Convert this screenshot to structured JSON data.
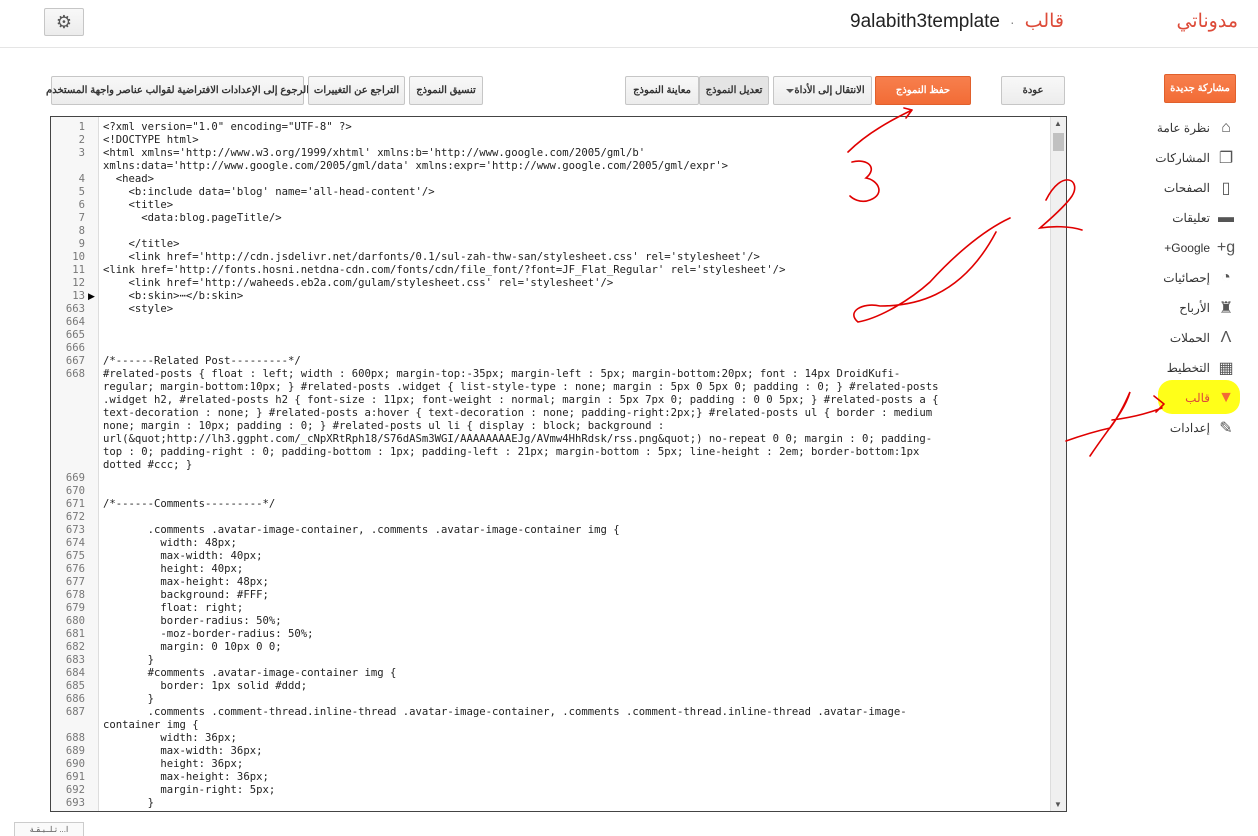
{
  "header": {
    "settings_icon": "gear-icon",
    "blog_name": "9alabith3template",
    "separator": "·",
    "page_title": "قالب",
    "brand": "مدوناتي"
  },
  "toolbar": {
    "reset_widgets": "الرجوع إلى الإعدادات الافتراضية لقوالب عناصر واجهة المستخدم",
    "revert_changes": "التراجع عن التغييرات",
    "format_template": "تنسيق النموذج",
    "preview_template": "معاينة النموذج",
    "edit_template": "تعديل النموذج",
    "jump_to_widget": "الانتقال إلى الأداة",
    "save_template": "حفظ النموذج",
    "back": "عودة"
  },
  "sidebar": {
    "new_post": "مشاركة جديدة",
    "items": [
      {
        "label": "نظرة عامة",
        "icon": "home-icon"
      },
      {
        "label": "المشاركات",
        "icon": "posts-icon"
      },
      {
        "label": "الصفحات",
        "icon": "pages-icon"
      },
      {
        "label": "تعليقات",
        "icon": "comment-icon"
      },
      {
        "label": "Google+",
        "icon": "google-plus-icon"
      },
      {
        "label": "إحصائيات",
        "icon": "pie-chart-icon"
      },
      {
        "label": "الأرباح",
        "icon": "trophy-icon"
      },
      {
        "label": "الحملات",
        "icon": "adwords-icon"
      },
      {
        "label": "التخطيط",
        "icon": "layout-icon"
      },
      {
        "label": "قالب",
        "icon": "paint-roller-icon"
      },
      {
        "label": "إعدادات",
        "icon": "wrench-icon"
      }
    ]
  },
  "editor": {
    "lines": [
      {
        "n": "1",
        "t": "<?xml version=\"1.0\" encoding=\"UTF-8\" ?>"
      },
      {
        "n": "2",
        "t": "<!DOCTYPE html>"
      },
      {
        "n": "3",
        "t": "<html xmlns='http://www.w3.org/1999/xhtml' xmlns:b='http://www.google.com/2005/gml/b'"
      },
      {
        "n": "",
        "t": "xmlns:data='http://www.google.com/2005/gml/data' xmlns:expr='http://www.google.com/2005/gml/expr'>"
      },
      {
        "n": "4",
        "t": "  <head>"
      },
      {
        "n": "5",
        "t": "    <b:include data='blog' name='all-head-content'/>"
      },
      {
        "n": "6",
        "t": "    <title>"
      },
      {
        "n": "7",
        "t": "      <data:blog.pageTitle/>"
      },
      {
        "n": "8",
        "t": ""
      },
      {
        "n": "9",
        "t": "    </title>"
      },
      {
        "n": "10",
        "t": "    <link href='http://cdn.jsdelivr.net/darfonts/0.1/sul-zah-thw-san/stylesheet.css' rel='stylesheet'/>"
      },
      {
        "n": "11",
        "t": "<link href='http://fonts.hosni.netdna-cdn.com/fonts/cdn/file_font/?font=JF_Flat_Regular' rel='stylesheet'/>"
      },
      {
        "n": "12",
        "t": "    <link href='http://waheeds.eb2a.com/gulam/stylesheet.css' rel='stylesheet'/>"
      },
      {
        "n": "13",
        "t": "    <b:skin>⋯</b:skin>"
      },
      {
        "n": "663",
        "t": "    <style>"
      },
      {
        "n": "664",
        "t": ""
      },
      {
        "n": "665",
        "t": ""
      },
      {
        "n": "666",
        "t": ""
      },
      {
        "n": "667",
        "t": "/*------Related Post---------*/"
      },
      {
        "n": "668",
        "t": "#related-posts { float : left; width : 600px; margin-top:-35px; margin-left : 5px; margin-bottom:20px; font : 14px DroidKufi-"
      },
      {
        "n": "",
        "t": "regular; margin-bottom:10px; } #related-posts .widget { list-style-type : none; margin : 5px 0 5px 0; padding : 0; } #related-posts"
      },
      {
        "n": "",
        "t": ".widget h2, #related-posts h2 { font-size : 11px; font-weight : normal; margin : 5px 7px 0; padding : 0 0 5px; } #related-posts a {"
      },
      {
        "n": "",
        "t": "text-decoration : none; } #related-posts a:hover { text-decoration : none; padding-right:2px;} #related-posts ul { border : medium"
      },
      {
        "n": "",
        "t": "none; margin : 10px; padding : 0; } #related-posts ul li { display : block; background :"
      },
      {
        "n": "",
        "t": "url(&quot;http://lh3.ggpht.com/_cNpXRtRph18/S76dASm3WGI/AAAAAAAAEJg/AVmw4HhRdsk/rss.png&quot;) no-repeat 0 0; margin : 0; padding-"
      },
      {
        "n": "",
        "t": "top : 0; padding-right : 0; padding-bottom : 1px; padding-left : 21px; margin-bottom : 5px; line-height : 2em; border-bottom:1px"
      },
      {
        "n": "",
        "t": "dotted #ccc; }"
      },
      {
        "n": "669",
        "t": ""
      },
      {
        "n": "670",
        "t": ""
      },
      {
        "n": "671",
        "t": "/*------Comments---------*/"
      },
      {
        "n": "672",
        "t": ""
      },
      {
        "n": "673",
        "t": "       .comments .avatar-image-container, .comments .avatar-image-container img {"
      },
      {
        "n": "674",
        "t": "         width: 48px;"
      },
      {
        "n": "675",
        "t": "         max-width: 40px;"
      },
      {
        "n": "676",
        "t": "         height: 40px;"
      },
      {
        "n": "677",
        "t": "         max-height: 48px;"
      },
      {
        "n": "678",
        "t": "         background: #FFF;"
      },
      {
        "n": "679",
        "t": "         float: right;"
      },
      {
        "n": "680",
        "t": "         border-radius: 50%;"
      },
      {
        "n": "681",
        "t": "         -moz-border-radius: 50%;"
      },
      {
        "n": "682",
        "t": "         margin: 0 10px 0 0;"
      },
      {
        "n": "683",
        "t": "       }"
      },
      {
        "n": "684",
        "t": "       #comments .avatar-image-container img {"
      },
      {
        "n": "685",
        "t": "         border: 1px solid #ddd;"
      },
      {
        "n": "686",
        "t": "       }"
      },
      {
        "n": "687",
        "t": "       .comments .comment-thread.inline-thread .avatar-image-container, .comments .comment-thread.inline-thread .avatar-image-"
      },
      {
        "n": "",
        "t": "container img {"
      },
      {
        "n": "688",
        "t": "         width: 36px;"
      },
      {
        "n": "689",
        "t": "         max-width: 36px;"
      },
      {
        "n": "690",
        "t": "         height: 36px;"
      },
      {
        "n": "691",
        "t": "         max-height: 36px;"
      },
      {
        "n": "692",
        "t": "         margin-right: 5px;"
      },
      {
        "n": "693",
        "t": "       }"
      }
    ],
    "fold_markers": [
      "13"
    ]
  },
  "annotations": {
    "labels": [
      "1",
      "2",
      "3"
    ],
    "highlight_color": "#ffff00",
    "ink_color": "#e00000"
  },
  "bottom_tab": "ا... تـلــبـقـة"
}
